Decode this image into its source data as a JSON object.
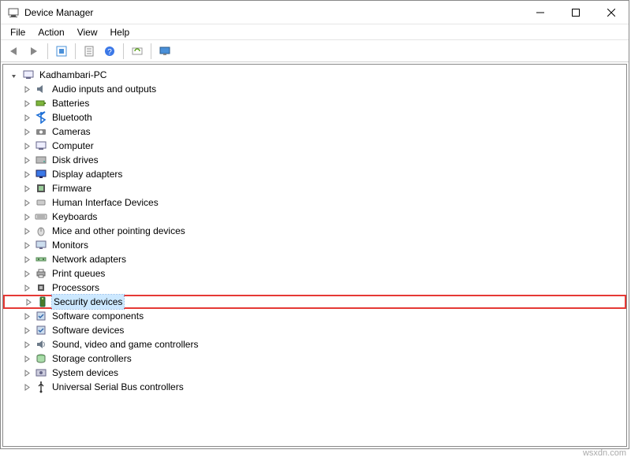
{
  "window": {
    "title": "Device Manager"
  },
  "menu": {
    "items": [
      "File",
      "Action",
      "View",
      "Help"
    ]
  },
  "toolbar": {
    "buttons": [
      {
        "name": "back",
        "enabled": false
      },
      {
        "name": "forward",
        "enabled": false
      },
      {
        "name": "show-hidden",
        "enabled": true
      },
      {
        "name": "properties",
        "enabled": true
      },
      {
        "name": "help",
        "enabled": true
      },
      {
        "name": "scan",
        "enabled": true
      },
      {
        "name": "monitor",
        "enabled": true
      }
    ]
  },
  "tree": {
    "root": {
      "label": "Kadhambari-PC",
      "icon": "computer"
    },
    "children": [
      {
        "label": "Audio inputs and outputs",
        "icon": "audio"
      },
      {
        "label": "Batteries",
        "icon": "battery"
      },
      {
        "label": "Bluetooth",
        "icon": "bluetooth"
      },
      {
        "label": "Cameras",
        "icon": "camera"
      },
      {
        "label": "Computer",
        "icon": "computer"
      },
      {
        "label": "Disk drives",
        "icon": "disk"
      },
      {
        "label": "Display adapters",
        "icon": "display"
      },
      {
        "label": "Firmware",
        "icon": "firmware"
      },
      {
        "label": "Human Interface Devices",
        "icon": "hid"
      },
      {
        "label": "Keyboards",
        "icon": "keyboard"
      },
      {
        "label": "Mice and other pointing devices",
        "icon": "mouse"
      },
      {
        "label": "Monitors",
        "icon": "monitor"
      },
      {
        "label": "Network adapters",
        "icon": "network"
      },
      {
        "label": "Print queues",
        "icon": "printer"
      },
      {
        "label": "Processors",
        "icon": "cpu"
      },
      {
        "label": "Security devices",
        "icon": "security",
        "selected": true,
        "highlighted": true
      },
      {
        "label": "Software components",
        "icon": "software"
      },
      {
        "label": "Software devices",
        "icon": "software"
      },
      {
        "label": "Sound, video and game controllers",
        "icon": "sound"
      },
      {
        "label": "Storage controllers",
        "icon": "storage"
      },
      {
        "label": "System devices",
        "icon": "system"
      },
      {
        "label": "Universal Serial Bus controllers",
        "icon": "usb"
      }
    ]
  },
  "watermark": "wsxdn.com"
}
